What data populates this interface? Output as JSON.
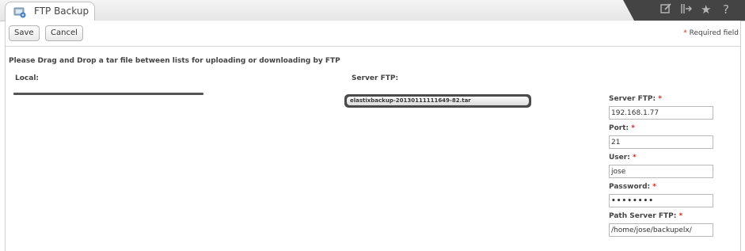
{
  "tab": {
    "title": "FTP Backup",
    "icon": "ftp-backup-icon"
  },
  "tab_tools": [
    "edit-icon",
    "expand-icon",
    "star-icon",
    "help-icon"
  ],
  "toolbar": {
    "save_label": "Save",
    "cancel_label": "Cancel",
    "required_star": "*",
    "required_note": "Required field"
  },
  "instructions": "Please Drag and Drop a tar file between lists for uploading or downloading by FTP",
  "local": {
    "label": "Local:"
  },
  "server": {
    "label": "Server FTP:",
    "files": [
      "elastixbackup-20130111111649-82.tar"
    ]
  },
  "form": {
    "required_star": "*",
    "server": {
      "label": "Server FTP:",
      "value": "192.168.1.77"
    },
    "port": {
      "label": "Port:",
      "value": "21"
    },
    "user": {
      "label": "User:",
      "value": "jose"
    },
    "password": {
      "label": "Password:",
      "value": "••••••••"
    },
    "path": {
      "label": "Path Server FTP:",
      "value": "/home/jose/backupelx/"
    }
  },
  "colors": {
    "required": "#e0241b",
    "tool_bg": "#444444"
  }
}
